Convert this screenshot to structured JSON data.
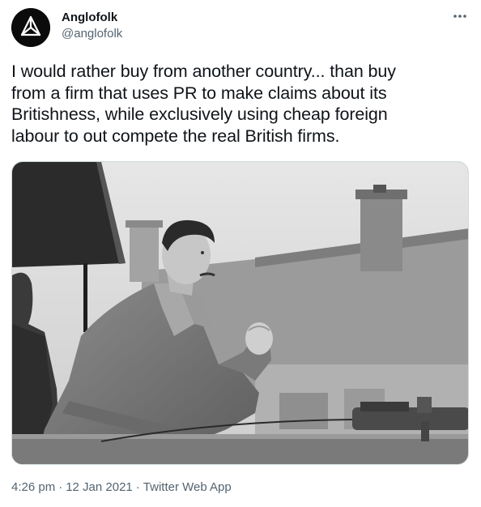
{
  "author": {
    "display_name": "Anglofolk",
    "handle": "@anglofolk"
  },
  "icons": {
    "avatar": "triangle-rune-logo-icon",
    "more": "more-horizontal-icon"
  },
  "tweet": {
    "text": "I would rather buy from another country... than buy\nfrom a firm that uses PR to make claims about its\nBritishness, while exclusively using cheap foreign\nlabour to out compete the real British firms."
  },
  "media": {
    "alt": "Black and white photograph of a man in a trench coat raising his fist while speaking outdoors"
  },
  "meta": {
    "time": "4:26 pm",
    "separator1": "·",
    "date": "12 Jan 2021",
    "separator2": "·",
    "source": "Twitter Web App"
  },
  "colors": {
    "text": "#0f1419",
    "secondary": "#536471",
    "border": "#cfd9de"
  }
}
